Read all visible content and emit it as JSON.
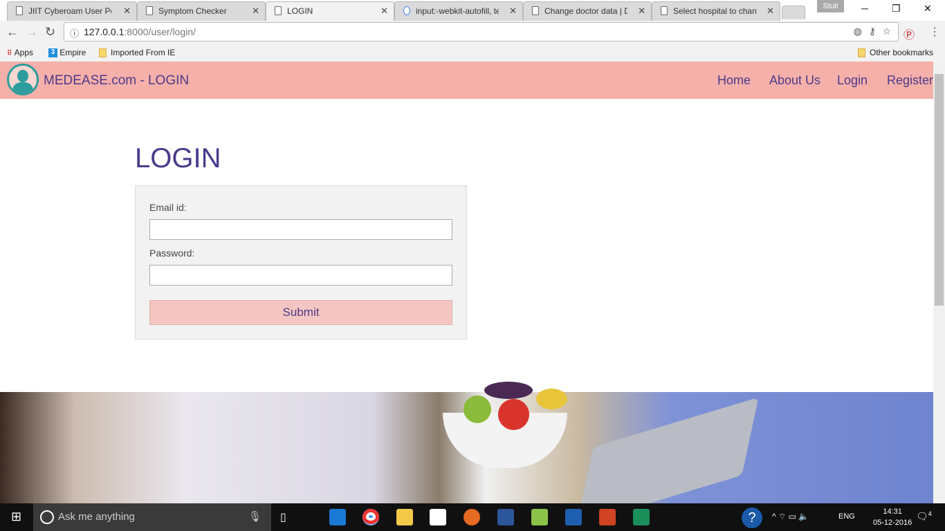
{
  "browser": {
    "tabs": [
      {
        "label": "JIIT Cyberoam User Port"
      },
      {
        "label": "Symptom Checker"
      },
      {
        "label": "LOGIN"
      },
      {
        "label": "input:-webkit-autofill, te"
      },
      {
        "label": "Change doctor data | D"
      },
      {
        "label": "Select hospital to chang"
      }
    ],
    "user": "Stuti",
    "url_host": "127.0.0.1",
    "url_rest": ":8000/user/login/",
    "bookmarks": [
      {
        "label": "Apps"
      },
      {
        "label": "Empire"
      },
      {
        "label": "Imported From IE"
      }
    ],
    "other_bookmarks": "Other bookmarks"
  },
  "site": {
    "brand": "MEDEASE.com - LOGIN",
    "nav": [
      {
        "label": "Home"
      },
      {
        "label": "About Us"
      },
      {
        "label": "Login"
      },
      {
        "label": "Register"
      }
    ],
    "title": "LOGIN",
    "form": {
      "email_label": "Email id:",
      "email_value": "",
      "password_label": "Password:",
      "password_value": "",
      "submit": "Submit"
    },
    "colors": {
      "header": "#f5b0a9",
      "accent": "#4b3a8c",
      "button": "#f4c6c2"
    }
  },
  "taskbar": {
    "search_placeholder": "Ask me anything",
    "lang": "ENG",
    "time": "14:31",
    "date": "05-12-2016",
    "notifications": "4"
  }
}
